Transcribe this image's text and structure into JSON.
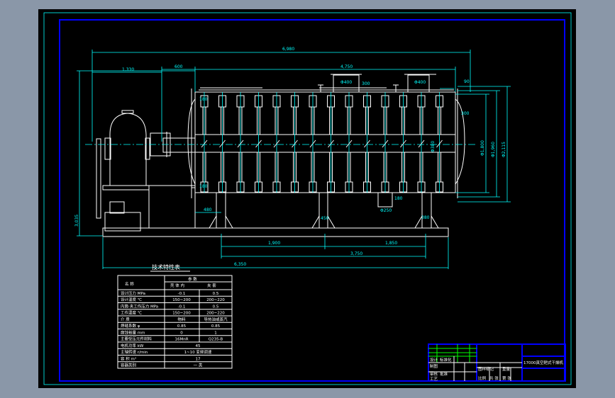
{
  "drawing": {
    "dimensions": {
      "overall_length": "6,980",
      "left_offset": "1,330",
      "coupling": "600",
      "body_length": "4,750",
      "nozzle_a": "Φ400",
      "nozzle_a_h": "300",
      "nozzle_b": "Φ400",
      "end_gap": "90",
      "end_300": "300",
      "d1": "Φ1,800",
      "d2": "Φ1,960",
      "d3": "Φ2,115",
      "shaft": "Φ380",
      "outlet": "Φ250",
      "outlet_h": "180",
      "leg_off": "480",
      "leg_mid": "450",
      "leg_right": "380",
      "span1": "1,900",
      "span2": "1,850",
      "span_total": "3,750",
      "base_length": "6,350",
      "height": "3,035",
      "paddle_top": "180",
      "paddle_bot": "180"
    },
    "tech_table": {
      "title": "技术特性表",
      "header": {
        "name": "名    称",
        "param": "参    数",
        "inner": "壳 体 内",
        "jacket": "夹    套"
      },
      "rows": [
        {
          "name": "设计压力  MPa",
          "inner": "-0.1",
          "jacket": "0.5"
        },
        {
          "name": "设计温度   ℃",
          "inner": "150~200",
          "jacket": "200~220"
        },
        {
          "name": "内筒·夹工作压力 MPa",
          "inner": "-0.1",
          "jacket": "0.5"
        },
        {
          "name": "工作温度   ℃",
          "inner": "150~200",
          "jacket": "200~220"
        },
        {
          "name": "介    质",
          "inner": "物料",
          "jacket": "导热油或蒸汽"
        },
        {
          "name": "焊缝系数   φ",
          "inner": "0.85",
          "jacket": "0.85"
        },
        {
          "name": "腐蚀裕量  mm",
          "inner": "0",
          "jacket": "1"
        },
        {
          "name": "主要受压元件材料",
          "inner": "16MnR",
          "jacket": "Q235-B"
        },
        {
          "name": "电机功率  kW",
          "merged": "45"
        },
        {
          "name": "主轴转速 r/min",
          "merged": "1~10 变频调速"
        },
        {
          "name": "容    积  m³",
          "merged": "17"
        },
        {
          "name": "容器类别",
          "merged": "一 类"
        }
      ]
    },
    "title_block": {
      "drawing_name": "17000真空耙式干燥机",
      "cells": [
        "设计",
        "制图",
        "审核",
        "工艺",
        "标准化",
        "批准",
        "图样标记",
        "重量",
        "比例",
        "共  张",
        "第  张"
      ]
    }
  }
}
